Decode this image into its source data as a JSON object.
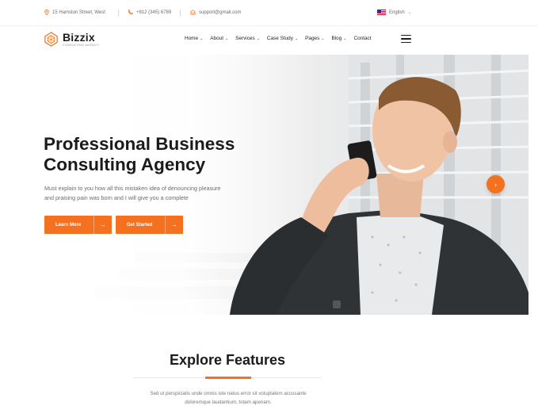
{
  "topbar": {
    "address": "15 Hamston Street, West",
    "phone": "+812 (345) 6789",
    "email": "support@gmail.com",
    "language": "English"
  },
  "brand": {
    "name": "Bizzix",
    "tagline": "CONSULTING AGENCY"
  },
  "nav": {
    "items": [
      {
        "label": "Home",
        "has_dropdown": true
      },
      {
        "label": "About",
        "has_dropdown": true
      },
      {
        "label": "Services",
        "has_dropdown": true
      },
      {
        "label": "Case Study",
        "has_dropdown": true
      },
      {
        "label": "Pages",
        "has_dropdown": true
      },
      {
        "label": "Blog",
        "has_dropdown": true
      },
      {
        "label": "Contact",
        "has_dropdown": false
      }
    ],
    "chevron": "⌄"
  },
  "hero": {
    "title_line1": "Professional Business",
    "title_line2": "Consulting Agency",
    "text_line1": "Must explain to you how all this mistaken idea of denouncing pleasure",
    "text_line2": "and praising pain was born and I will give you a complete",
    "btn_primary": "Learn More",
    "btn_secondary": "Get Started"
  },
  "features": {
    "title": "Explore Features",
    "text_line1": "Sed ut perspiciatis unde omnis iste natus error sit voluptatem accusante",
    "text_line2": "doloremque laudantium, totam aperiam."
  },
  "colors": {
    "accent": "#f3711f",
    "heading": "#1b1b1b",
    "body_text": "#6c6c6c"
  }
}
